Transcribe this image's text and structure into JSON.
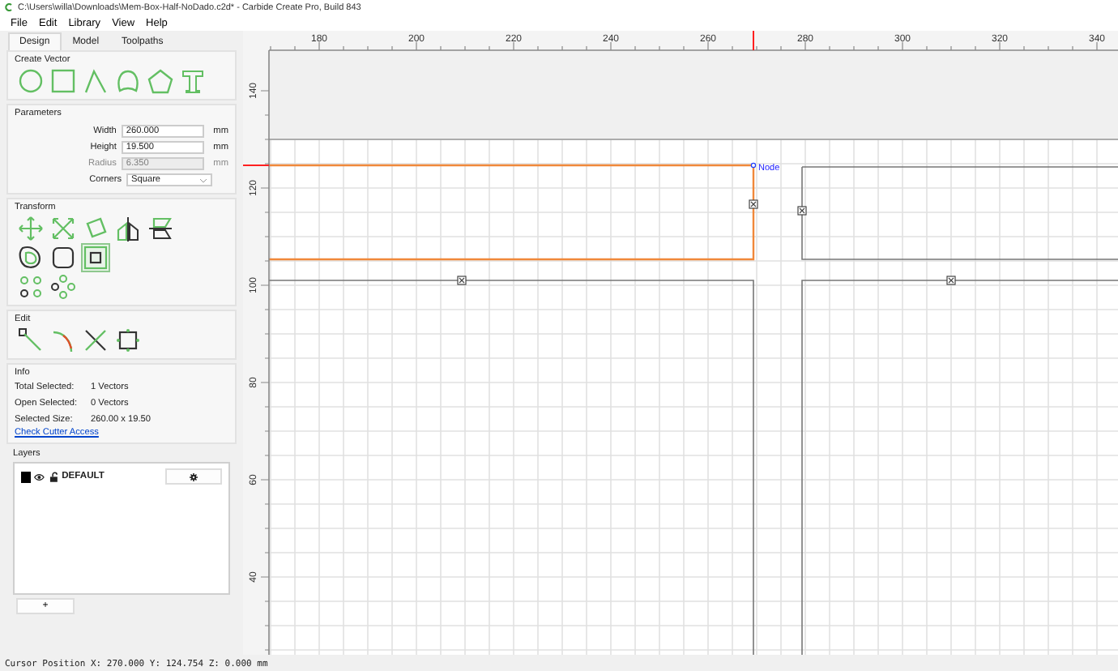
{
  "window": {
    "title": "C:\\Users\\willa\\Downloads\\Mem-Box-Half-NoDado.c2d* - Carbide Create Pro, Build 843"
  },
  "menu": [
    "File",
    "Edit",
    "Library",
    "View",
    "Help"
  ],
  "tabs": [
    {
      "label": "Design",
      "selected": true
    },
    {
      "label": "Model",
      "selected": false
    },
    {
      "label": "Toolpaths",
      "selected": false
    }
  ],
  "create_vector": {
    "title": "Create Vector"
  },
  "parameters": {
    "title": "Parameters",
    "fields": [
      {
        "label": "Width",
        "value": "260.000",
        "unit": "mm",
        "disabled": false
      },
      {
        "label": "Height",
        "value": "19.500",
        "unit": "mm",
        "disabled": false
      },
      {
        "label": "Radius",
        "value": "6.350",
        "unit": "mm",
        "disabled": true
      }
    ],
    "corners": {
      "label": "Corners",
      "value": "Square"
    }
  },
  "transform": {
    "title": "Transform"
  },
  "edit": {
    "title": "Edit"
  },
  "info": {
    "title": "Info",
    "rows": [
      {
        "label": "Total Selected:",
        "value": "1 Vectors"
      },
      {
        "label": "Open Selected:",
        "value": "0 Vectors"
      },
      {
        "label": "Selected Size:",
        "value": "260.00 x 19.50"
      }
    ],
    "link": "Check Cutter Access"
  },
  "layers": {
    "title": "Layers",
    "items": [
      {
        "name": "DEFAULT"
      }
    ],
    "add_button": "+"
  },
  "rulers": {
    "x_labels": [
      "180",
      "200",
      "220",
      "240",
      "260",
      "280",
      "300",
      "320",
      "340"
    ],
    "y_labels": [
      "140",
      "120",
      "100",
      "80",
      "60",
      "40"
    ]
  },
  "canvas": {
    "node_label": "Node"
  },
  "status_bar": "Cursor Position X: 270.000 Y: 124.754 Z: 0.000 mm"
}
